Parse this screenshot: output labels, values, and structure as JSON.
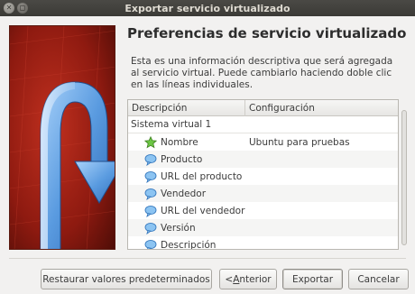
{
  "window": {
    "title": "Exportar servicio virtualizado"
  },
  "page": {
    "heading": "Preferencias de servicio virtualizado",
    "description": "Esta es una información descriptiva que será agregada al servicio virtual. Puede cambiarlo haciendo doble clic en las líneas individuales."
  },
  "table": {
    "columns": [
      "Descripción",
      "Configuración"
    ],
    "group": "Sistema virtual 1",
    "rows": [
      {
        "label": "Nombre",
        "value": "Ubuntu para pruebas",
        "icon": "green-star-icon"
      },
      {
        "label": "Producto",
        "value": "",
        "icon": "speech-bubble-icon"
      },
      {
        "label": "URL del producto",
        "value": "",
        "icon": "speech-bubble-icon"
      },
      {
        "label": "Vendedor",
        "value": "",
        "icon": "speech-bubble-icon"
      },
      {
        "label": "URL del vendedor",
        "value": "",
        "icon": "speech-bubble-icon"
      },
      {
        "label": "Versión",
        "value": "",
        "icon": "speech-bubble-icon"
      },
      {
        "label": "Descripción",
        "value": "",
        "icon": "speech-bubble-icon"
      }
    ]
  },
  "buttons": {
    "restore": "Restaurar valores predeterminados",
    "back_prefix": "< ",
    "back_mnemonic": "A",
    "back_rest": "nterior",
    "export": "Exportar",
    "cancel": "Cancelar"
  },
  "colors": {
    "banner_red": "#8e1a10",
    "arrow_blue": "#5a9be0",
    "titlebar": "#3c3b37"
  }
}
